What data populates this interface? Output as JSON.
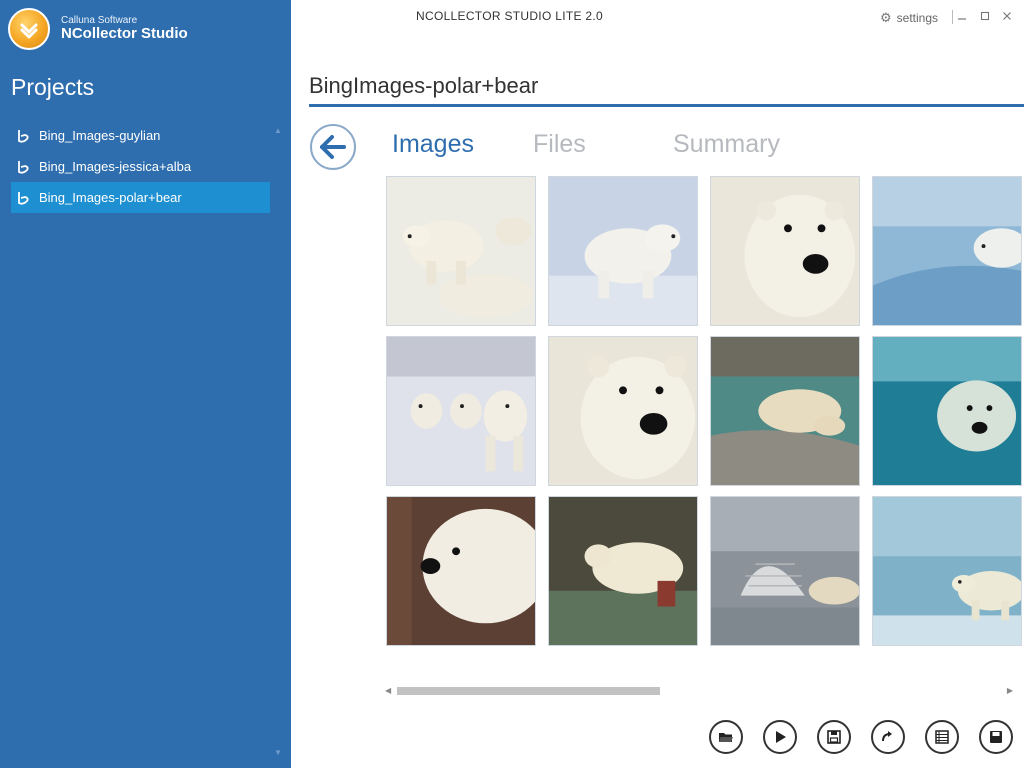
{
  "brand": {
    "company": "Calluna Software",
    "product": "NCollector Studio"
  },
  "app_title": "NCOLLECTOR STUDIO LITE 2.0",
  "settings_label": "settings",
  "sidebar": {
    "title": "Projects",
    "items": [
      {
        "label": "Bing_Images-guylian",
        "selected": false
      },
      {
        "label": "Bing_Images-jessica+alba",
        "selected": false
      },
      {
        "label": "Bing_Images-polar+bear",
        "selected": true
      }
    ]
  },
  "project_title": "BingImages-polar+bear",
  "tabs": [
    {
      "label": "Images",
      "active": true
    },
    {
      "label": "Files",
      "active": false
    },
    {
      "label": "Summary",
      "active": false
    }
  ],
  "images": [
    "polar bears resting on snow",
    "polar bear cub on snow",
    "polar bear face close-up",
    "polar bear on ice edge",
    "three polar bear cubs walking",
    "polar bear face portrait",
    "polar bear lying on rock by water",
    "polar bear swimming underwater",
    "polar bear head profile",
    "polar bear splashing in water",
    "polar bear by igloo",
    "polar bear walking on ice"
  ],
  "toolbar_icons": [
    "open-folder-icon",
    "play-icon",
    "save-icon",
    "redo-icon",
    "list-icon",
    "save-as-icon"
  ],
  "colors": {
    "sidebar": "#2f6eae",
    "selected_item": "#1e8fd0",
    "accent": "#2f6eae",
    "tab_inactive": "#b6b9bd"
  }
}
